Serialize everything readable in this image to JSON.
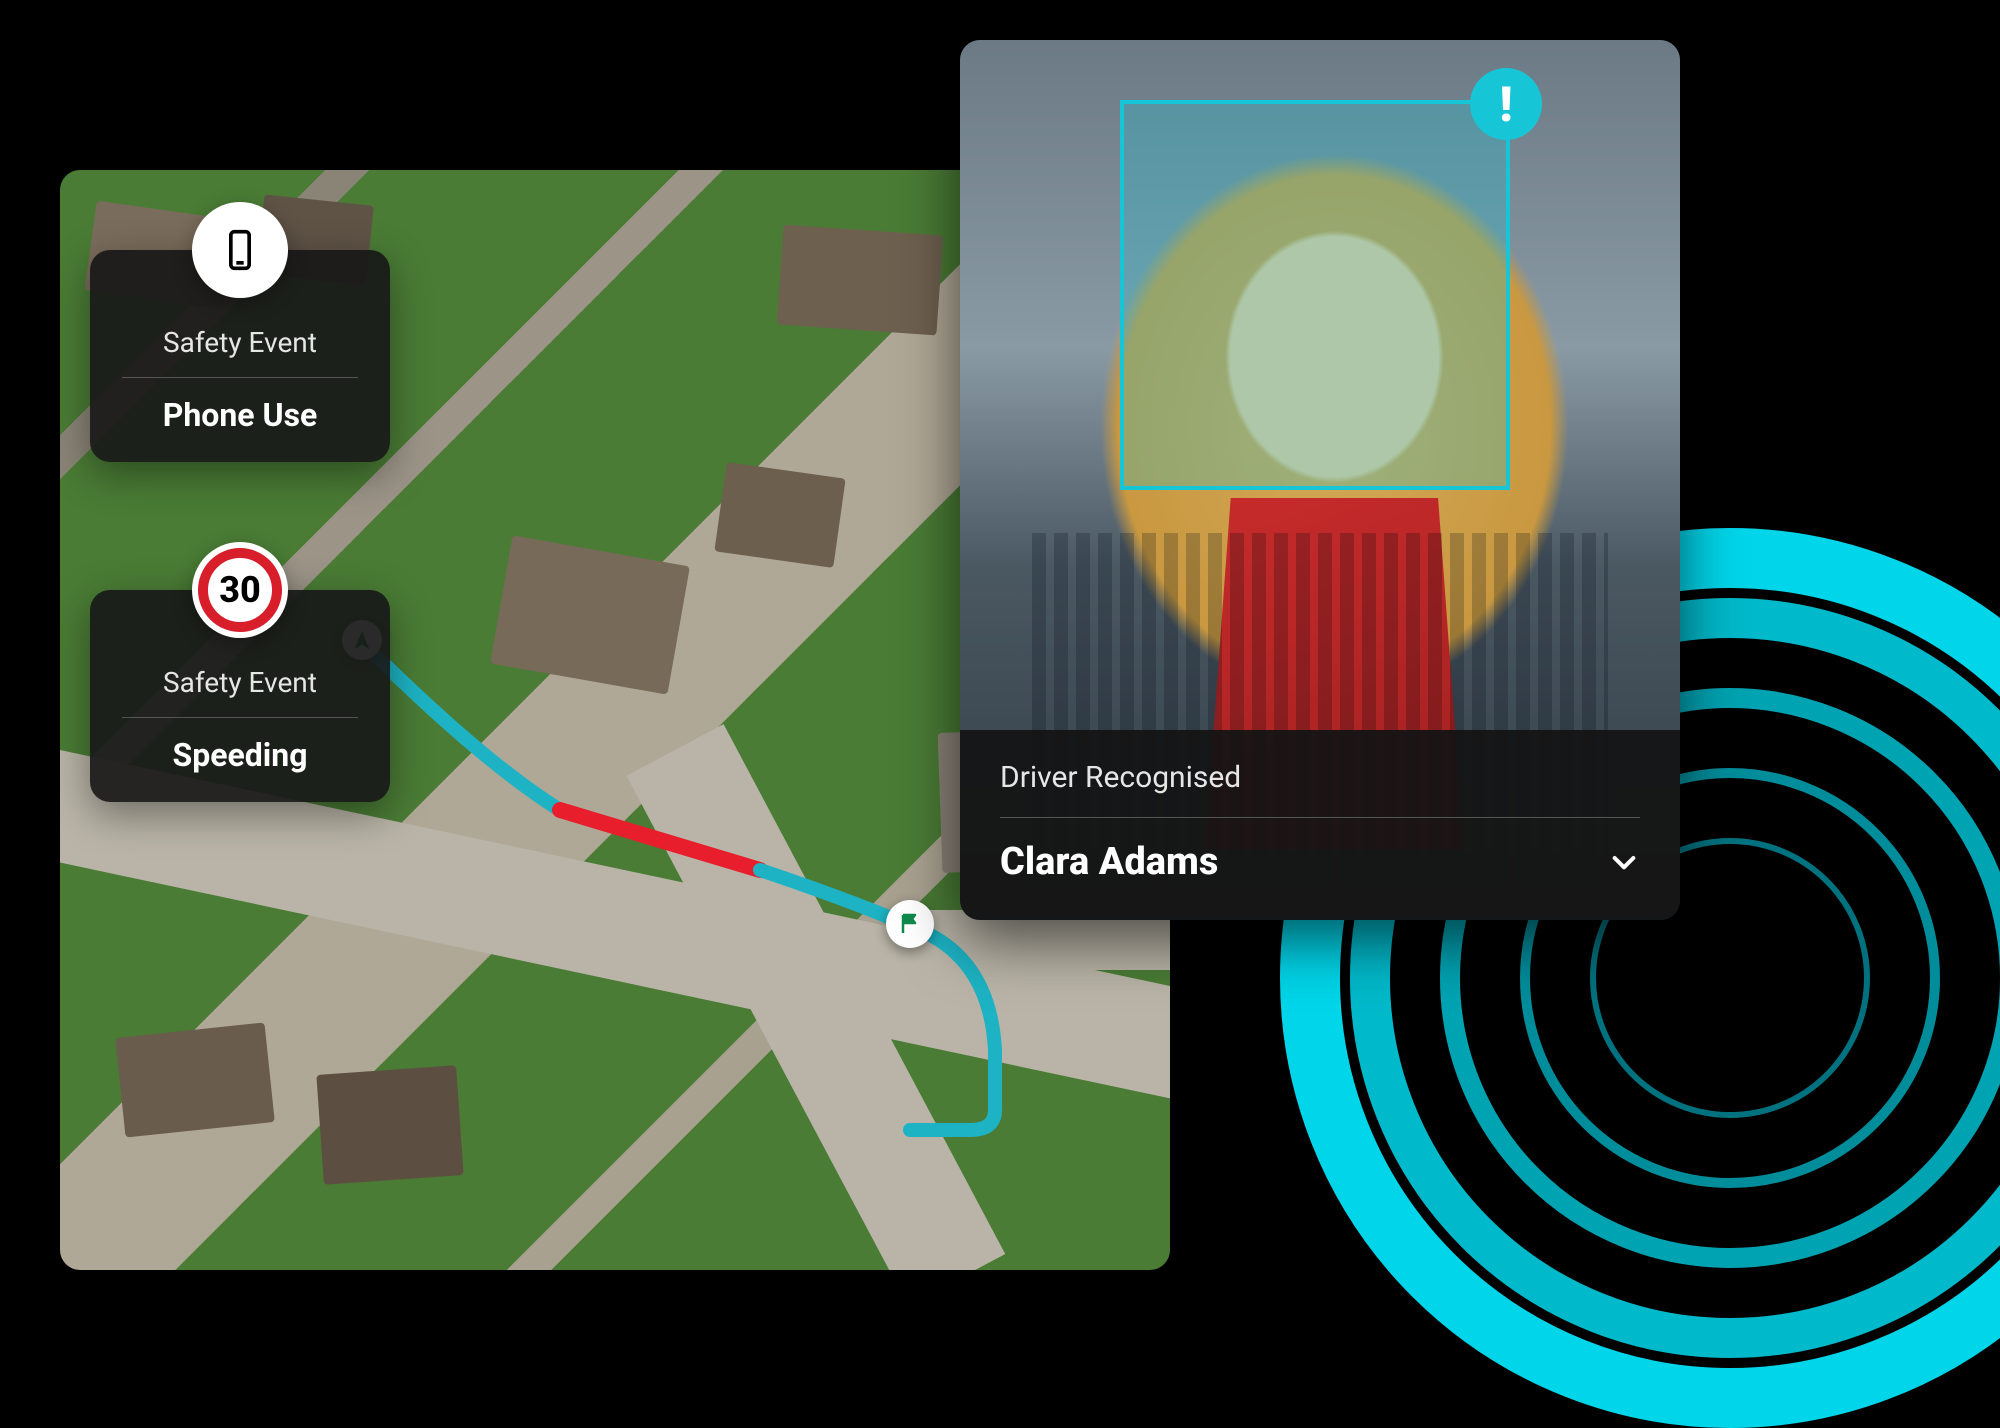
{
  "events": [
    {
      "label": "Safety Event",
      "value": "Phone Use",
      "icon": "phone-icon"
    },
    {
      "label": "Safety Event",
      "value": "Speeding",
      "icon": "speed-limit-icon",
      "speed_limit": "30"
    }
  ],
  "driver": {
    "recognised_label": "Driver Recognised",
    "name": "Clara Adams",
    "alert_glyph": "!"
  },
  "colors": {
    "accent": "#17c6d6",
    "route_normal": "#1db3c4",
    "route_alert": "#e81e2d",
    "speed_ring": "#d81e2a"
  }
}
